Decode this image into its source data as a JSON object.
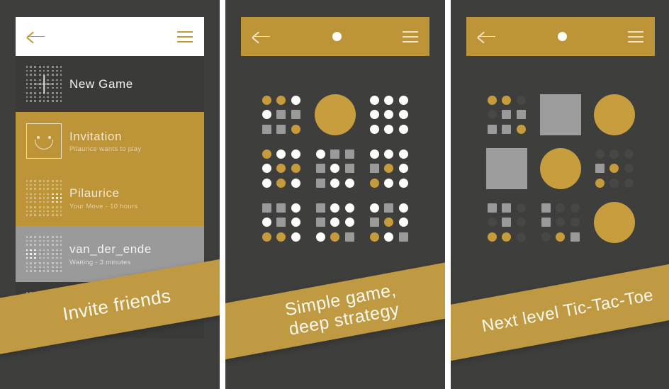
{
  "meta": {
    "app_theme": {
      "gold": "#bd9438",
      "dark": "#3e3e3c",
      "gray": "#9a9a9a",
      "white": "#fdfdfb"
    }
  },
  "panels": [
    {
      "id": "panel-game-list",
      "topbar": {
        "style": "white",
        "back_icon": "back-arrow-icon",
        "menu_icon": "hamburger-menu-icon",
        "center_icon": null
      },
      "rows": [
        {
          "style": "dark",
          "icon": "new-game-grid-icon",
          "title": "New Game",
          "subtitle": ""
        },
        {
          "style": "gold",
          "icon": "smiley-face-icon",
          "title": "Invitation",
          "subtitle": "Pilaurice wants to play"
        },
        {
          "style": "gold2",
          "icon": "mini-board-icon",
          "title": "Pilaurice",
          "subtitle": "Your Move - 10 hours"
        },
        {
          "style": "gray",
          "icon": "mini-board-icon",
          "title": "van_der_ende",
          "subtitle": "Waiting - 3 minutes"
        },
        {
          "style": "dark2",
          "icon": "mini-board-icon",
          "title": "",
          "subtitle": ""
        }
      ],
      "ribbon": {
        "text": "Invite friends",
        "class": "ribbon-1"
      }
    },
    {
      "id": "panel-active-game",
      "topbar": {
        "style": "gold",
        "back_icon": "back-arrow-icon",
        "menu_icon": "hamburger-menu-icon",
        "center_icon": "turn-indicator-white-dot"
      },
      "ribbon": {
        "text": "Simple game,\ndeep strategy",
        "class": "ribbon-2"
      }
    },
    {
      "id": "panel-advanced-game",
      "topbar": {
        "style": "gold",
        "back_icon": "back-arrow-icon",
        "menu_icon": "hamburger-menu-icon",
        "center_icon": "turn-indicator-white-dot"
      },
      "ribbon": {
        "text": "Next level Tic-Tac-Toe",
        "class": "ribbon-3"
      }
    }
  ],
  "board_data": {
    "type": "ultimate-tic-tac-toe",
    "legend": {
      "circle_gold": "player-gold-piece",
      "circle_white": "empty-open-cell",
      "square_gray": "player-gray-piece",
      "dim": "closed-empty-cell",
      "big_circle_gold": "sub-board-won-by-gold",
      "big_square_gray": "sub-board-won-by-gray"
    },
    "board_middle": [
      {
        "index": 0,
        "won": null,
        "cells": [
          {
            "shape": "circle",
            "color": "gold"
          },
          {
            "shape": "circle",
            "color": "gold"
          },
          {
            "shape": "circle",
            "color": "white"
          },
          {
            "shape": "circle",
            "color": "white"
          },
          {
            "shape": "square",
            "color": "gray"
          },
          {
            "shape": "square",
            "color": "gray"
          },
          {
            "shape": "square",
            "color": "gray"
          },
          {
            "shape": "square",
            "color": "gray"
          },
          {
            "shape": "circle",
            "color": "gold"
          }
        ]
      },
      {
        "index": 1,
        "won": "gold",
        "won_shape": "circle",
        "cells": []
      },
      {
        "index": 2,
        "won": null,
        "cells": [
          {
            "shape": "circle",
            "color": "white"
          },
          {
            "shape": "circle",
            "color": "white"
          },
          {
            "shape": "circle",
            "color": "white"
          },
          {
            "shape": "circle",
            "color": "white"
          },
          {
            "shape": "circle",
            "color": "white"
          },
          {
            "shape": "circle",
            "color": "white"
          },
          {
            "shape": "circle",
            "color": "white"
          },
          {
            "shape": "circle",
            "color": "white"
          },
          {
            "shape": "circle",
            "color": "white"
          }
        ]
      },
      {
        "index": 3,
        "won": null,
        "cells": [
          {
            "shape": "circle",
            "color": "gold"
          },
          {
            "shape": "circle",
            "color": "white"
          },
          {
            "shape": "circle",
            "color": "white"
          },
          {
            "shape": "circle",
            "color": "white"
          },
          {
            "shape": "circle",
            "color": "gold"
          },
          {
            "shape": "circle",
            "color": "gold"
          },
          {
            "shape": "circle",
            "color": "white"
          },
          {
            "shape": "circle",
            "color": "gold"
          },
          {
            "shape": "circle",
            "color": "white"
          }
        ]
      },
      {
        "index": 4,
        "won": null,
        "cells": [
          {
            "shape": "circle",
            "color": "white"
          },
          {
            "shape": "square",
            "color": "gray"
          },
          {
            "shape": "square",
            "color": "gray"
          },
          {
            "shape": "square",
            "color": "gray"
          },
          {
            "shape": "circle",
            "color": "white"
          },
          {
            "shape": "square",
            "color": "gray"
          },
          {
            "shape": "square",
            "color": "gray"
          },
          {
            "shape": "circle",
            "color": "white"
          },
          {
            "shape": "circle",
            "color": "white"
          }
        ]
      },
      {
        "index": 5,
        "won": null,
        "cells": [
          {
            "shape": "circle",
            "color": "white"
          },
          {
            "shape": "circle",
            "color": "white"
          },
          {
            "shape": "circle",
            "color": "white"
          },
          {
            "shape": "square",
            "color": "gray"
          },
          {
            "shape": "circle",
            "color": "gold"
          },
          {
            "shape": "circle",
            "color": "white"
          },
          {
            "shape": "circle",
            "color": "gold"
          },
          {
            "shape": "circle",
            "color": "white"
          },
          {
            "shape": "circle",
            "color": "white"
          }
        ]
      },
      {
        "index": 6,
        "won": null,
        "cells": [
          {
            "shape": "square",
            "color": "gray"
          },
          {
            "shape": "square",
            "color": "gray"
          },
          {
            "shape": "circle",
            "color": "white"
          },
          {
            "shape": "circle",
            "color": "white"
          },
          {
            "shape": "square",
            "color": "gray"
          },
          {
            "shape": "circle",
            "color": "white"
          },
          {
            "shape": "circle",
            "color": "gold"
          },
          {
            "shape": "circle",
            "color": "gold"
          },
          {
            "shape": "circle",
            "color": "white"
          }
        ]
      },
      {
        "index": 7,
        "won": null,
        "cells": [
          {
            "shape": "square",
            "color": "gray"
          },
          {
            "shape": "circle",
            "color": "white"
          },
          {
            "shape": "circle",
            "color": "white"
          },
          {
            "shape": "square",
            "color": "gray"
          },
          {
            "shape": "circle",
            "color": "white"
          },
          {
            "shape": "circle",
            "color": "white"
          },
          {
            "shape": "circle",
            "color": "white"
          },
          {
            "shape": "circle",
            "color": "gold"
          },
          {
            "shape": "square",
            "color": "gray"
          }
        ]
      },
      {
        "index": 8,
        "won": null,
        "cells": [
          {
            "shape": "circle",
            "color": "white"
          },
          {
            "shape": "square",
            "color": "gray"
          },
          {
            "shape": "circle",
            "color": "white"
          },
          {
            "shape": "square",
            "color": "gray"
          },
          {
            "shape": "circle",
            "color": "gold"
          },
          {
            "shape": "circle",
            "color": "white"
          },
          {
            "shape": "circle",
            "color": "gold"
          },
          {
            "shape": "circle",
            "color": "white"
          },
          {
            "shape": "square",
            "color": "gray"
          }
        ]
      }
    ],
    "board_right": [
      {
        "index": 0,
        "won": null,
        "cells": [
          {
            "shape": "circle",
            "color": "gold"
          },
          {
            "shape": "circle",
            "color": "gold"
          },
          {
            "shape": "circle",
            "color": "dim"
          },
          {
            "shape": "circle",
            "color": "dim"
          },
          {
            "shape": "square",
            "color": "gray"
          },
          {
            "shape": "square",
            "color": "gray"
          },
          {
            "shape": "square",
            "color": "gray"
          },
          {
            "shape": "square",
            "color": "gray"
          },
          {
            "shape": "circle",
            "color": "gold"
          }
        ]
      },
      {
        "index": 1,
        "won": "gray",
        "won_shape": "square",
        "cells": []
      },
      {
        "index": 2,
        "won": "gold",
        "won_shape": "circle",
        "cells": []
      },
      {
        "index": 3,
        "won": "gray",
        "won_shape": "square",
        "cells": []
      },
      {
        "index": 4,
        "won": "gold",
        "won_shape": "circle",
        "cells": []
      },
      {
        "index": 5,
        "won": null,
        "cells": [
          {
            "shape": "circle",
            "color": "dim"
          },
          {
            "shape": "circle",
            "color": "dim"
          },
          {
            "shape": "circle",
            "color": "dim"
          },
          {
            "shape": "square",
            "color": "gray"
          },
          {
            "shape": "circle",
            "color": "gold"
          },
          {
            "shape": "circle",
            "color": "dim"
          },
          {
            "shape": "circle",
            "color": "gold"
          },
          {
            "shape": "circle",
            "color": "dim"
          },
          {
            "shape": "circle",
            "color": "dim"
          }
        ]
      },
      {
        "index": 6,
        "won": null,
        "cells": [
          {
            "shape": "square",
            "color": "gray"
          },
          {
            "shape": "square",
            "color": "gray"
          },
          {
            "shape": "circle",
            "color": "dim"
          },
          {
            "shape": "circle",
            "color": "dim"
          },
          {
            "shape": "square",
            "color": "gray"
          },
          {
            "shape": "circle",
            "color": "dim"
          },
          {
            "shape": "circle",
            "color": "gold"
          },
          {
            "shape": "circle",
            "color": "gold"
          },
          {
            "shape": "circle",
            "color": "dim"
          }
        ]
      },
      {
        "index": 7,
        "won": null,
        "cells": [
          {
            "shape": "square",
            "color": "gray"
          },
          {
            "shape": "circle",
            "color": "dim"
          },
          {
            "shape": "circle",
            "color": "dim"
          },
          {
            "shape": "square",
            "color": "gray"
          },
          {
            "shape": "circle",
            "color": "dim"
          },
          {
            "shape": "circle",
            "color": "dim"
          },
          {
            "shape": "circle",
            "color": "dim"
          },
          {
            "shape": "circle",
            "color": "gold"
          },
          {
            "shape": "square",
            "color": "gray"
          }
        ]
      },
      {
        "index": 8,
        "won": "gold",
        "won_shape": "circle",
        "cells": []
      }
    ]
  }
}
